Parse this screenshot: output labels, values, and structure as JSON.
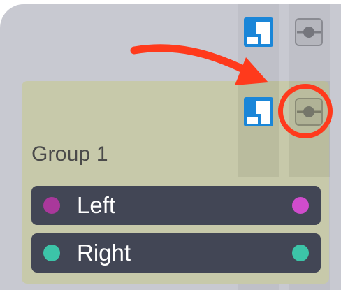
{
  "group": {
    "title": "Group 1"
  },
  "channels": [
    {
      "label": "Left",
      "color": "#a9389b",
      "end_color": "#d04ccc"
    },
    {
      "label": "Right",
      "color": "#3cc4a8",
      "end_color": "#3cc4a8"
    }
  ],
  "icons": {
    "solo": "blue-split-square-icon",
    "link": "circle-node-icon"
  },
  "colors": {
    "background": "#c8c9d1",
    "group_background": "#c7c9aa",
    "row_background": "#424655",
    "annotation": "#ff3a1c",
    "solo_blue": "#1a86d8"
  }
}
